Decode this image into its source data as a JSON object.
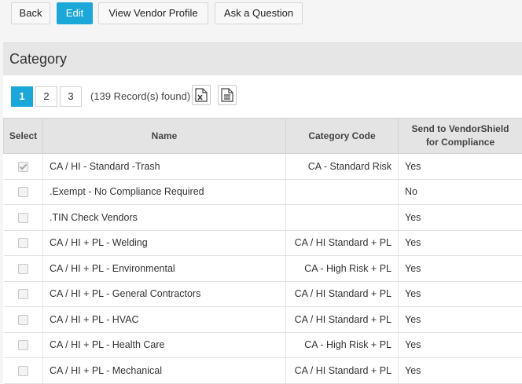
{
  "toolbar": {
    "back_label": "Back",
    "edit_label": "Edit",
    "view_profile_label": "View Vendor Profile",
    "ask_label": "Ask a Question"
  },
  "section": {
    "title": "Category"
  },
  "pager": {
    "pages": [
      "1",
      "2",
      "3"
    ],
    "active_page": "1",
    "records_text": "(139 Record(s) found)",
    "excel_icon": "excel-export-icon",
    "doc_icon": "document-export-icon"
  },
  "table": {
    "headers": {
      "select": "Select",
      "name": "Name",
      "code": "Category Code",
      "send_line1": "Send to VendorShield",
      "send_line2": "for Compliance"
    },
    "rows": [
      {
        "checked": true,
        "name": "CA / HI - Standard -Trash",
        "code": "CA - Standard Risk",
        "send": "Yes"
      },
      {
        "checked": false,
        "name": ".Exempt - No Compliance Required",
        "code": "",
        "send": "No"
      },
      {
        "checked": false,
        "name": ".TIN Check Vendors",
        "code": "",
        "send": "Yes"
      },
      {
        "checked": false,
        "name": "CA / HI + PL - Welding",
        "code": "CA / HI Standard + PL",
        "send": "Yes"
      },
      {
        "checked": false,
        "name": "CA / HI + PL - Environmental",
        "code": "CA - High Risk + PL",
        "send": "Yes"
      },
      {
        "checked": false,
        "name": "CA / HI + PL - General Contractors",
        "code": "CA / HI Standard + PL",
        "send": "Yes"
      },
      {
        "checked": false,
        "name": "CA / HI + PL - HVAC",
        "code": "CA / HI Standard + PL",
        "send": "Yes"
      },
      {
        "checked": false,
        "name": "CA / HI + PL - Health Care",
        "code": "CA - High Risk + PL",
        "send": "Yes"
      },
      {
        "checked": false,
        "name": "CA / HI + PL - Mechanical",
        "code": "CA / HI Standard + PL",
        "send": "Yes"
      }
    ]
  },
  "colors": {
    "accent": "#1ba8d9",
    "header_bg": "#e4e4e4"
  }
}
